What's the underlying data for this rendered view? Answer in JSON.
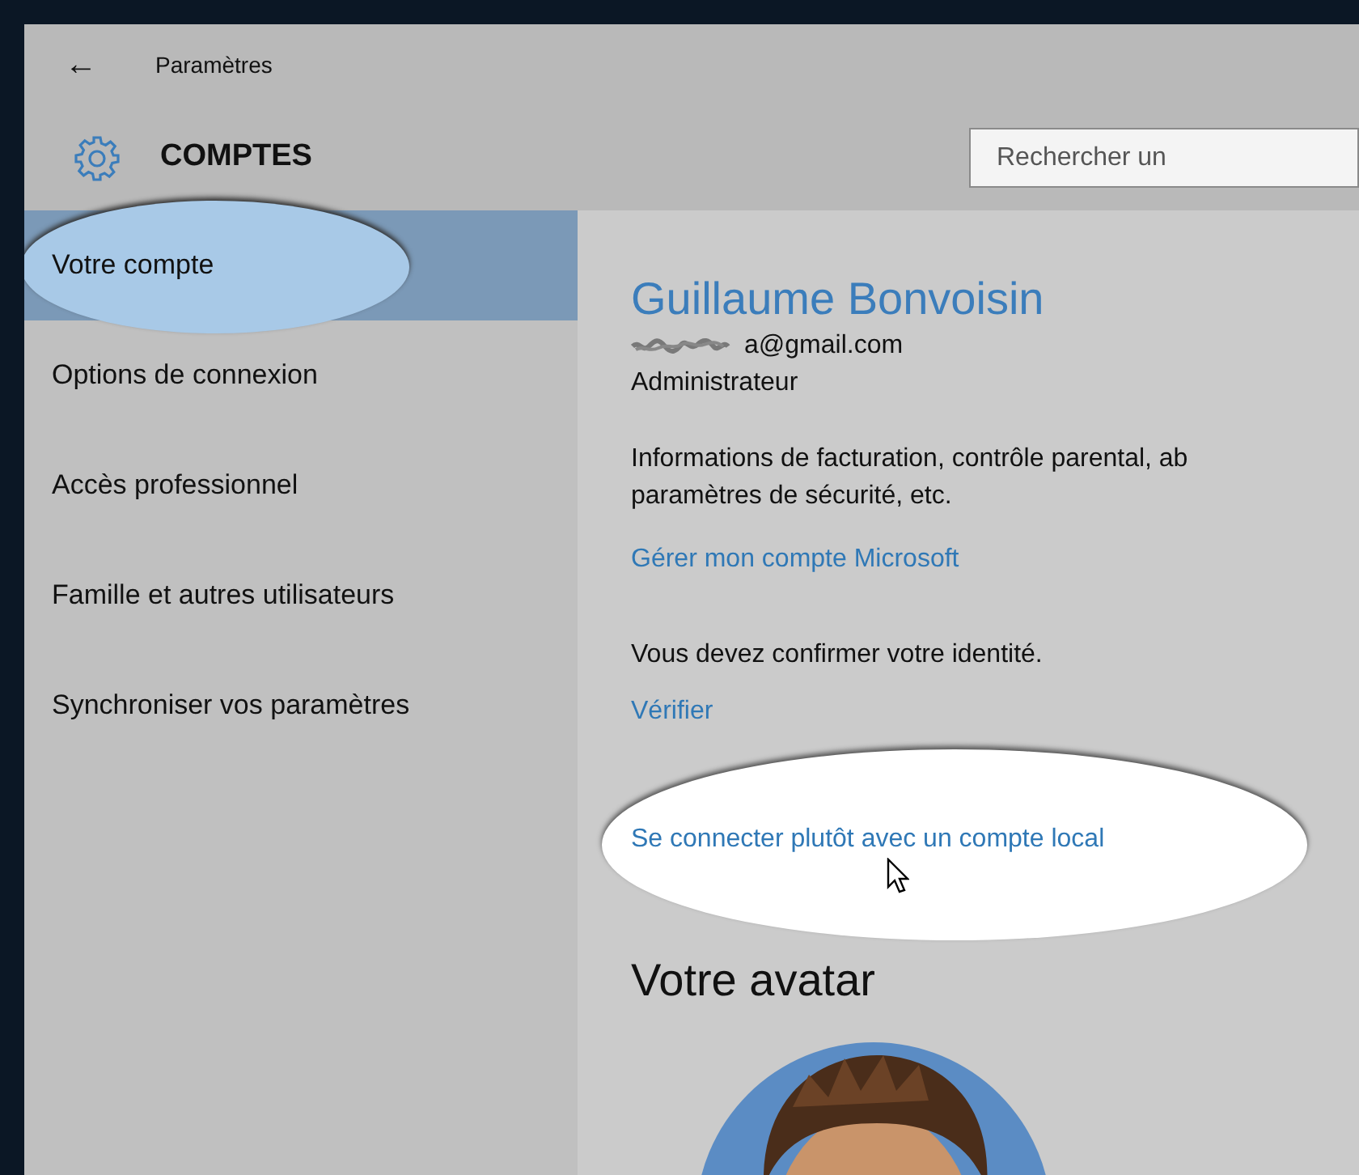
{
  "window": {
    "back": "←",
    "title": "Paramètres"
  },
  "header": {
    "title": "COMPTES",
    "search": {
      "placeholder": "Rechercher un"
    }
  },
  "sidebar": {
    "items": [
      {
        "label": "Votre compte",
        "selected": true,
        "highlighted": true
      },
      {
        "label": "Options de connexion",
        "selected": false,
        "highlighted": false
      },
      {
        "label": "Accès professionnel",
        "selected": false,
        "highlighted": false
      },
      {
        "label": "Famille et autres utilisateurs",
        "selected": false,
        "highlighted": false
      },
      {
        "label": "Synchroniser vos paramètres",
        "selected": false,
        "highlighted": false
      }
    ]
  },
  "account": {
    "name": "Guillaume Bonvoisin",
    "email": "a@gmail.com",
    "email_blurred": true,
    "role": "Administrateur",
    "info_lines": [
      "Informations de facturation, contrôle parental, ab",
      "paramètres de sécurité, etc."
    ],
    "manage_link": "Gérer mon compte Microsoft",
    "verify_text": "Vous devez confirmer votre identité.",
    "verify_link": "Vérifier",
    "local_link": {
      "label": "Se connecter plutôt avec un compte local",
      "highlighted": true,
      "pointer": true
    }
  },
  "avatar": {
    "title": "Votre avatar"
  }
}
